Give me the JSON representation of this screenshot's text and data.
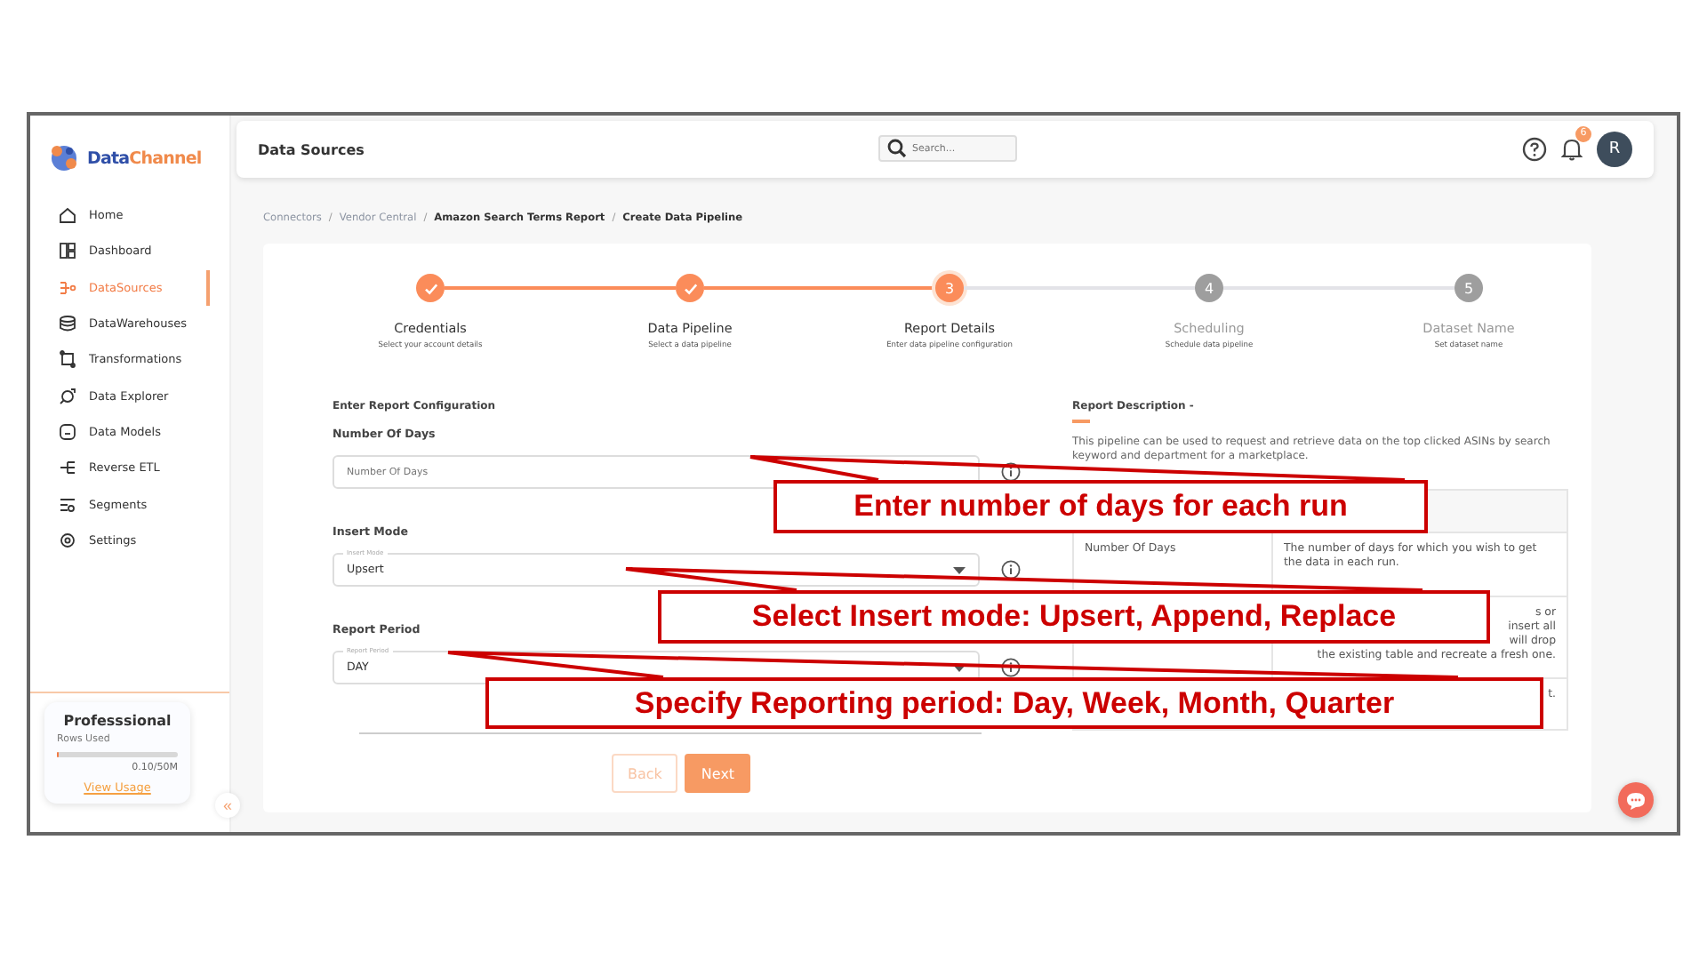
{
  "sidebar": {
    "logo": {
      "part1": "Data",
      "part2": "Channel"
    },
    "items": [
      {
        "label": "Home",
        "selected": false
      },
      {
        "label": "Dashboard",
        "selected": false
      },
      {
        "label": "DataSources",
        "selected": true
      },
      {
        "label": "DataWarehouses",
        "selected": false
      },
      {
        "label": "Transformations",
        "selected": false
      },
      {
        "label": "Data Explorer",
        "selected": false
      },
      {
        "label": "Data Models",
        "selected": false
      },
      {
        "label": "Reverse ETL",
        "selected": false
      },
      {
        "label": "Segments",
        "selected": false
      },
      {
        "label": "Settings",
        "selected": false
      }
    ],
    "plan": {
      "name": "Professsional",
      "rows_label": "Rows Used",
      "level": 0.002,
      "usage": "0.10/50M",
      "link": "View Usage"
    },
    "collapse": "«"
  },
  "header": {
    "title": "Data Sources",
    "search_placeholder": "Search...",
    "notification_count": "6",
    "avatar": "R"
  },
  "breadcrumb": [
    {
      "label": "Connectors",
      "emphasis": false
    },
    {
      "separator": "/",
      "label": "Vendor Central",
      "emphasis": false
    },
    {
      "separator": "/",
      "label": "Amazon Search Terms Report",
      "emphasis": true
    },
    {
      "separator": "/",
      "label": "Create Data Pipeline",
      "emphasis": true
    }
  ],
  "steps": [
    {
      "completed": true,
      "title": "Credentials",
      "subtitle": "Select your account details"
    },
    {
      "completed": true,
      "title": "Data Pipeline",
      "subtitle": "Select a data pipeline"
    },
    {
      "completed": false,
      "number": "3",
      "title": "Report Details",
      "subtitle": "Enter data pipeline configuration"
    },
    {
      "completed": false,
      "number": "4",
      "title": "Scheduling",
      "subtitle": "Schedule data pipeline"
    },
    {
      "completed": false,
      "number": "5",
      "title": "Dataset Name",
      "subtitle": "Set dataset name"
    }
  ],
  "form": {
    "heading": "Enter Report Configuration",
    "fields": [
      {
        "kind": "input",
        "label": "Number Of Days",
        "placeholder": "Number Of Days"
      },
      {
        "kind": "select",
        "label": "Insert Mode",
        "floating_label": "Insert Mode",
        "value": "Upsert"
      },
      {
        "kind": "select",
        "label": "Report Period",
        "floating_label": "Report Period",
        "value": "DAY"
      }
    ],
    "buttons": [
      {
        "label": "Back",
        "disabled": true
      },
      {
        "label": "Next",
        "disabled": false
      }
    ]
  },
  "description": {
    "title": "Report Description -",
    "text": "This pipeline can be used to request and retrieve data on the top clicked ASINs by search keyword and department for a marketplace.",
    "rows": [
      {
        "parameter": "Number Of Days",
        "description": "The number of days for which you wish to get the data in each run."
      },
      {
        "fragments": [
          "s or",
          "insert all",
          "will drop",
          "the existing table and recreate a fresh one."
        ]
      },
      {
        "fragments": [
          "t."
        ]
      }
    ]
  },
  "annotations": [
    {
      "text": "Enter number of days for each run"
    },
    {
      "text": "Select Insert mode: Upsert, Append, Replace"
    },
    {
      "text": "Specify Reporting period: Day, Week, Month, Quarter"
    }
  ]
}
